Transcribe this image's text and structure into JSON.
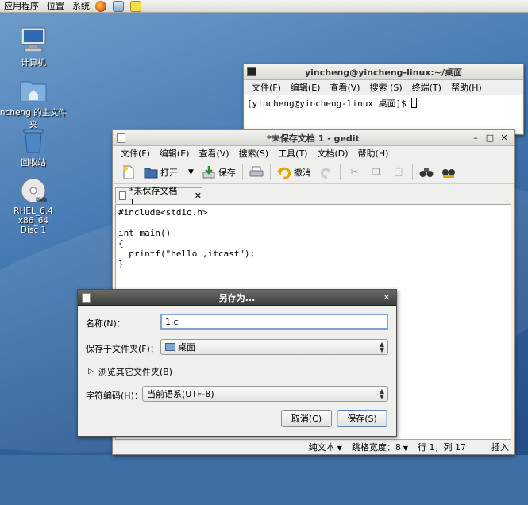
{
  "top_panel": {
    "menus": [
      "应用程序",
      "位置",
      "系统"
    ]
  },
  "desktop": {
    "icons": [
      {
        "label": "计算机",
        "icon": "computer-icon"
      },
      {
        "label": "ncheng 的主文件夹",
        "icon": "home-folder-icon"
      },
      {
        "label": "回收站",
        "icon": "trash-icon"
      },
      {
        "label": "RHEL_6.4 x86_64",
        "label2": "Disc 1",
        "icon": "dvd-icon"
      }
    ]
  },
  "terminal": {
    "title": "yincheng@yincheng-linux:~/桌面",
    "menus": [
      "文件(F)",
      "编辑(E)",
      "查看(V)",
      "搜索 (S)",
      "终端(T)",
      "帮助(H)"
    ],
    "prompt": "[yincheng@yincheng-linux 桌面]$ "
  },
  "gedit": {
    "title": "*未保存文档 1 - gedit",
    "menus": [
      "文件(F)",
      "编辑(E)",
      "查看(V)",
      "搜索(S)",
      "工具(T)",
      "文档(D)",
      "帮助(H)"
    ],
    "toolbar": {
      "open": "打开",
      "save": "保存",
      "undo": "撤消"
    },
    "tab_label": "*未保存文档 1",
    "code": [
      "#include<stdio.h>",
      "",
      "int main()",
      "{",
      "  printf(\"hello ,itcast\");",
      "}"
    ],
    "status": {
      "mode": "纯文本",
      "tab_width": "跳格宽度：8",
      "position": "行 1，列 17",
      "insert": "插入"
    }
  },
  "save_dialog": {
    "title": "另存为...",
    "name_label": "名称(N)：",
    "name_value": "1.c",
    "folder_label": "保存于文件夹(F)：",
    "folder_value": "桌面",
    "browse_label": "浏览其它文件夹(B)",
    "encoding_label": "字符编码(H)：",
    "encoding_value": "当前语系(UTF-8)",
    "cancel": "取消(C)",
    "save": "保存(S)"
  },
  "colors": {
    "desktop": "#4b7eb6",
    "window_bg": "#efefed",
    "dialog_title": "#3c3c39"
  }
}
